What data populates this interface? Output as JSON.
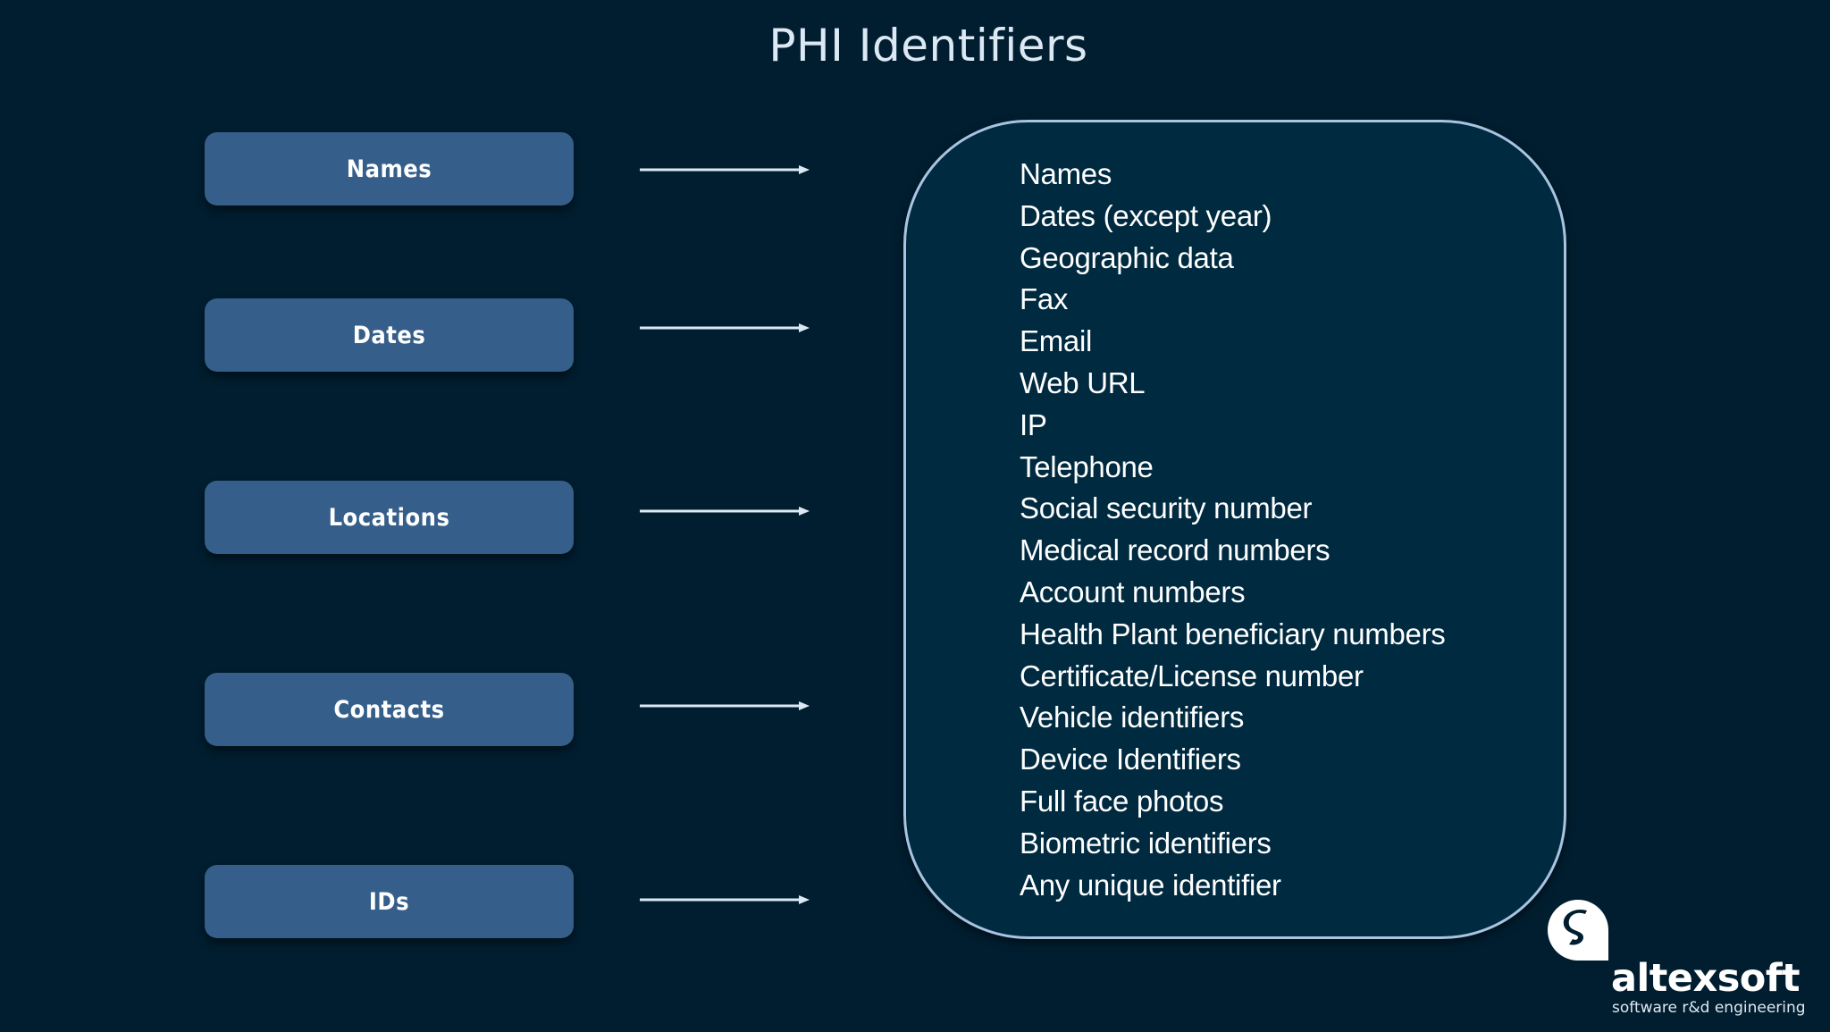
{
  "title": "PHI Identifiers",
  "colors": {
    "background": "#001e30",
    "category_box": "#355f8a",
    "panel_fill": "#002a40",
    "panel_border": "#a9c4e0",
    "arrow": "#dce8f4",
    "text": "#ffffff"
  },
  "categories": [
    {
      "label": "Names"
    },
    {
      "label": "Dates"
    },
    {
      "label": "Locations"
    },
    {
      "label": "Contacts"
    },
    {
      "label": "IDs"
    }
  ],
  "identifiers": [
    "Names",
    "Dates (except year)",
    "Geographic data",
    "Fax",
    "Email",
    "Web URL",
    "IP",
    "Telephone",
    "Social security number",
    "Medical record numbers",
    "Account numbers",
    "Health Plant beneficiary numbers",
    "Certificate/License number",
    "Vehicle identifiers",
    "Device Identifiers",
    "Full face photos",
    "Biometric identifiers",
    "Any unique identifier"
  ],
  "logo": {
    "icon": "altexsoft-logo-icon",
    "name": "altexsoft",
    "tagline": "software r&d engineering"
  }
}
